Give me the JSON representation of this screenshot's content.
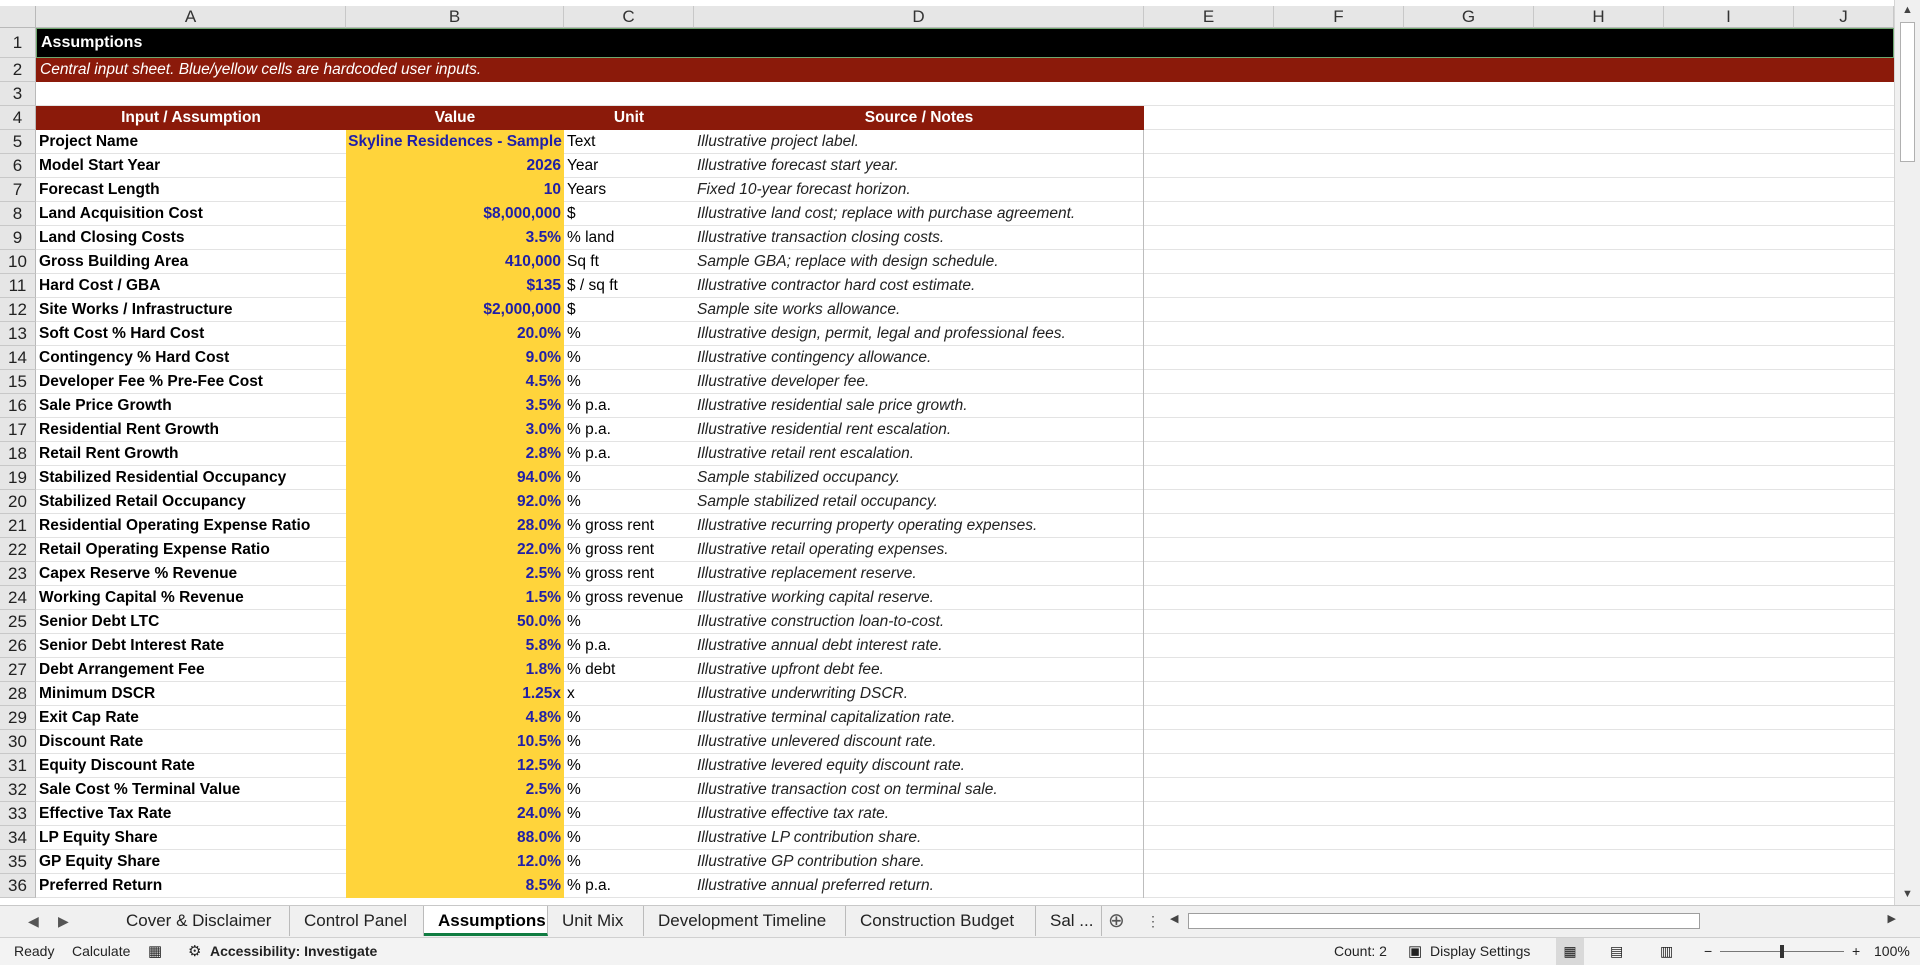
{
  "columns": [
    "A",
    "B",
    "C",
    "D",
    "E",
    "F",
    "G",
    "H",
    "I",
    "J"
  ],
  "title": "Assumptions",
  "subtitle": "Central input sheet. Blue/yellow cells are hardcoded user inputs.",
  "header": {
    "input": "Input / Assumption",
    "value": "Value",
    "unit": "Unit",
    "notes": "Source / Notes"
  },
  "rows": [
    {
      "label": "Project Name",
      "value": "Skyline Residences - Sample",
      "unit": "Text",
      "note": "Illustrative project label."
    },
    {
      "label": "Model Start Year",
      "value": "2026",
      "unit": "Year",
      "note": "Illustrative forecast start year."
    },
    {
      "label": "Forecast Length",
      "value": "10",
      "unit": "Years",
      "note": "Fixed 10-year forecast horizon."
    },
    {
      "label": "Land Acquisition Cost",
      "value": "$8,000,000",
      "unit": "$",
      "note": "Illustrative land cost; replace with purchase agreement."
    },
    {
      "label": "Land Closing Costs",
      "value": "3.5%",
      "unit": "% land",
      "note": "Illustrative transaction closing costs."
    },
    {
      "label": "Gross Building Area",
      "value": "410,000",
      "unit": "Sq ft",
      "note": "Sample GBA; replace with design schedule."
    },
    {
      "label": "Hard Cost / GBA",
      "value": "$135",
      "unit": "$ / sq ft",
      "note": "Illustrative contractor hard cost estimate."
    },
    {
      "label": "Site Works / Infrastructure",
      "value": "$2,000,000",
      "unit": "$",
      "note": "Sample site works allowance."
    },
    {
      "label": "Soft Cost % Hard Cost",
      "value": "20.0%",
      "unit": "%",
      "note": "Illustrative design, permit, legal and professional fees."
    },
    {
      "label": "Contingency % Hard Cost",
      "value": "9.0%",
      "unit": "%",
      "note": "Illustrative contingency allowance."
    },
    {
      "label": "Developer Fee % Pre-Fee Cost",
      "value": "4.5%",
      "unit": "%",
      "note": "Illustrative developer fee."
    },
    {
      "label": "Sale Price Growth",
      "value": "3.5%",
      "unit": "% p.a.",
      "note": "Illustrative residential sale price growth."
    },
    {
      "label": "Residential Rent Growth",
      "value": "3.0%",
      "unit": "% p.a.",
      "note": "Illustrative residential rent escalation."
    },
    {
      "label": "Retail Rent Growth",
      "value": "2.8%",
      "unit": "% p.a.",
      "note": "Illustrative retail rent escalation."
    },
    {
      "label": "Stabilized Residential Occupancy",
      "value": "94.0%",
      "unit": "%",
      "note": "Sample stabilized occupancy."
    },
    {
      "label": "Stabilized Retail Occupancy",
      "value": "92.0%",
      "unit": "%",
      "note": "Sample stabilized retail occupancy."
    },
    {
      "label": "Residential Operating Expense Ratio",
      "value": "28.0%",
      "unit": "% gross rent",
      "note": "Illustrative recurring property operating expenses."
    },
    {
      "label": "Retail Operating Expense Ratio",
      "value": "22.0%",
      "unit": "% gross rent",
      "note": "Illustrative retail operating expenses."
    },
    {
      "label": "Capex Reserve % Revenue",
      "value": "2.5%",
      "unit": "% gross rent",
      "note": "Illustrative replacement reserve."
    },
    {
      "label": "Working Capital % Revenue",
      "value": "1.5%",
      "unit": "% gross revenue",
      "note": "Illustrative working capital reserve."
    },
    {
      "label": "Senior Debt LTC",
      "value": "50.0%",
      "unit": "%",
      "note": "Illustrative construction loan-to-cost."
    },
    {
      "label": "Senior Debt Interest Rate",
      "value": "5.8%",
      "unit": "% p.a.",
      "note": "Illustrative annual debt interest rate."
    },
    {
      "label": "Debt Arrangement Fee",
      "value": "1.8%",
      "unit": "% debt",
      "note": "Illustrative upfront debt fee."
    },
    {
      "label": "Minimum DSCR",
      "value": "1.25x",
      "unit": "x",
      "note": "Illustrative underwriting DSCR."
    },
    {
      "label": "Exit Cap Rate",
      "value": "4.8%",
      "unit": "%",
      "note": "Illustrative terminal capitalization rate."
    },
    {
      "label": "Discount Rate",
      "value": "10.5%",
      "unit": "%",
      "note": "Illustrative unlevered discount rate."
    },
    {
      "label": "Equity Discount Rate",
      "value": "12.5%",
      "unit": "%",
      "note": "Illustrative levered equity discount rate."
    },
    {
      "label": "Sale Cost % Terminal Value",
      "value": "2.5%",
      "unit": "%",
      "note": "Illustrative transaction cost on terminal sale."
    },
    {
      "label": "Effective Tax Rate",
      "value": "24.0%",
      "unit": "%",
      "note": "Illustrative effective tax rate."
    },
    {
      "label": "LP Equity Share",
      "value": "88.0%",
      "unit": "%",
      "note": "Illustrative LP contribution share."
    },
    {
      "label": "GP Equity Share",
      "value": "12.0%",
      "unit": "%",
      "note": "Illustrative GP contribution share."
    },
    {
      "label": "Preferred Return",
      "value": "8.5%",
      "unit": "% p.a.",
      "note": "Illustrative annual preferred return."
    }
  ],
  "tabs": [
    "Cover & Disclaimer",
    "Control Panel",
    "Assumptions",
    "Unit Mix",
    "Development Timeline",
    "Construction Budget",
    "Sal ..."
  ],
  "active_tab": "Assumptions",
  "status": {
    "ready": "Ready",
    "calculate": "Calculate",
    "accessibility": "Accessibility: Investigate",
    "count": "Count: 2",
    "display": "Display Settings",
    "zoom": "100%"
  }
}
